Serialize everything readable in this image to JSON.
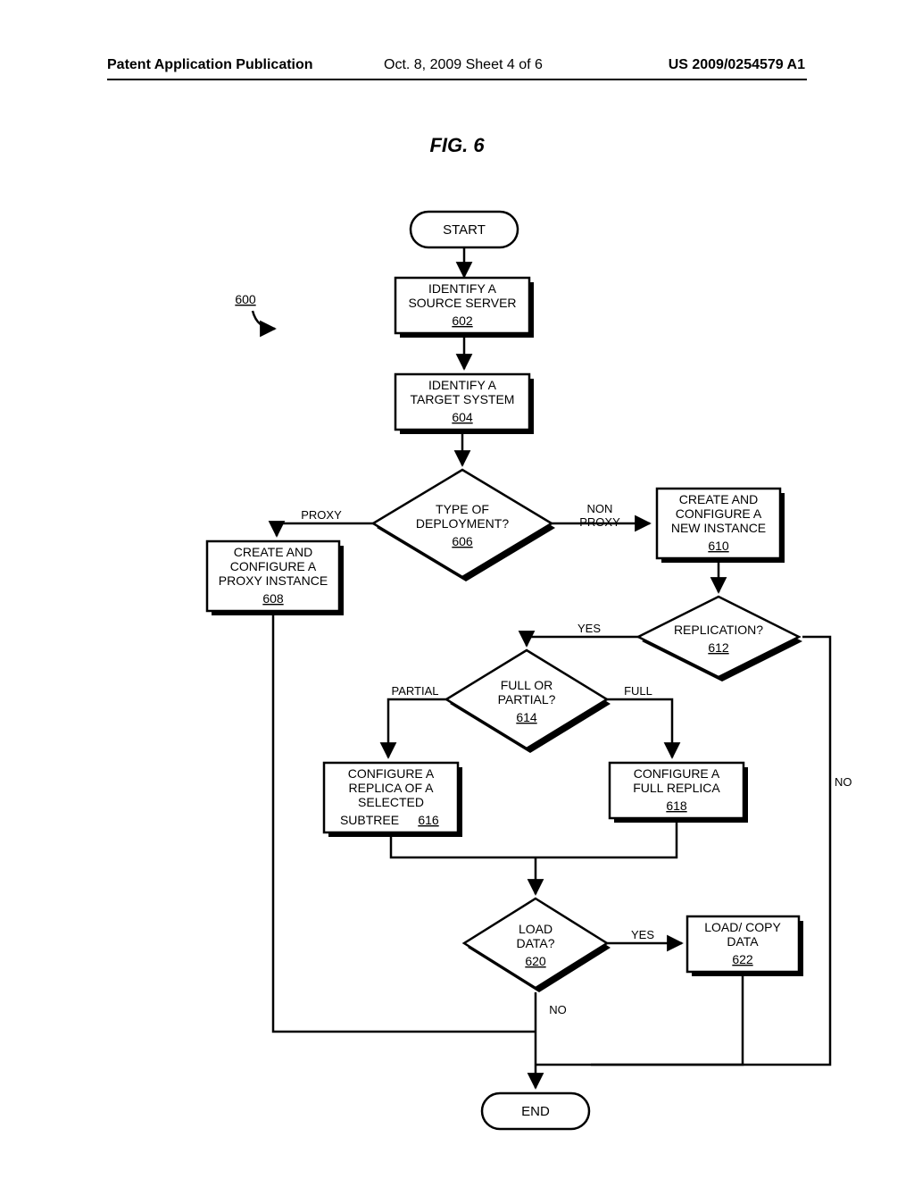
{
  "header": {
    "left": "Patent Application Publication",
    "mid": "Oct. 8, 2009  Sheet 4 of 6",
    "right": "US 2009/0254579 A1"
  },
  "figure_title": "FIG. 6",
  "flow_ref": "600",
  "nodes": {
    "start": "START",
    "n602_l1": "IDENTIFY A",
    "n602_l2": "SOURCE SERVER",
    "n602_ref": "602",
    "n604_l1": "IDENTIFY A",
    "n604_l2": "TARGET SYSTEM",
    "n604_ref": "604",
    "n606_l1": "TYPE OF",
    "n606_l2": "DEPLOYMENT?",
    "n606_ref": "606",
    "n608_l1": "CREATE AND",
    "n608_l2": "CONFIGURE A",
    "n608_l3": "PROXY INSTANCE",
    "n608_ref": "608",
    "n610_l1": "CREATE AND",
    "n610_l2": "CONFIGURE A",
    "n610_l3": "NEW INSTANCE",
    "n610_ref": "610",
    "n612_l1": "REPLICATION?",
    "n612_ref": "612",
    "n614_l1": "FULL OR",
    "n614_l2": "PARTIAL?",
    "n614_ref": "614",
    "n616_l1": "CONFIGURE A",
    "n616_l2": "REPLICA OF A",
    "n616_l3": "SELECTED",
    "n616_l4": "SUBTREE",
    "n616_ref": "616",
    "n618_l1": "CONFIGURE A",
    "n618_l2": "FULL REPLICA",
    "n618_ref": "618",
    "n620_l1": "LOAD",
    "n620_l2": "DATA?",
    "n620_ref": "620",
    "n622_l1": "LOAD/ COPY",
    "n622_l2": "DATA",
    "n622_ref": "622",
    "end": "END"
  },
  "edges": {
    "proxy": "PROXY",
    "nonproxy_l1": "NON",
    "nonproxy_l2": "PROXY",
    "yes": "YES",
    "no": "NO",
    "partial": "PARTIAL",
    "full": "FULL"
  }
}
